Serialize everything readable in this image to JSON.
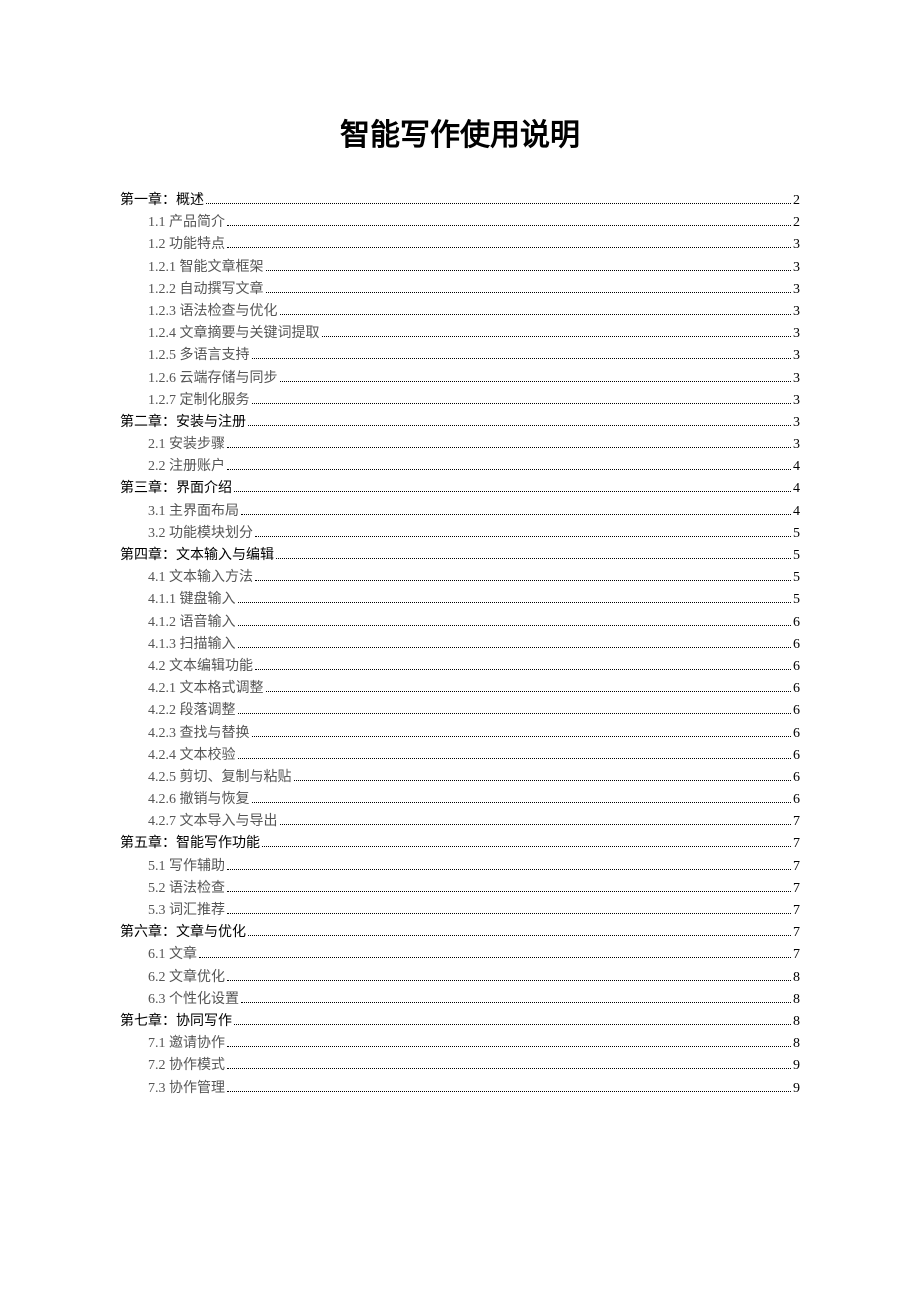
{
  "title": "智能写作使用说明",
  "toc": [
    {
      "label": "第一章：概述",
      "page": "2",
      "level": 0,
      "grey": false
    },
    {
      "label": "1.1 产品简介",
      "page": "2",
      "level": 1,
      "grey": true
    },
    {
      "label": "1.2 功能特点",
      "page": "3",
      "level": 1,
      "grey": true
    },
    {
      "label": "1.2.1 智能文章框架",
      "page": "3",
      "level": 1,
      "grey": true
    },
    {
      "label": "1.2.2 自动撰写文章",
      "page": "3",
      "level": 1,
      "grey": true
    },
    {
      "label": "1.2.3 语法检查与优化",
      "page": "3",
      "level": 1,
      "grey": true
    },
    {
      "label": "1.2.4 文章摘要与关键词提取",
      "page": "3",
      "level": 1,
      "grey": true
    },
    {
      "label": "1.2.5 多语言支持",
      "page": "3",
      "level": 1,
      "grey": true
    },
    {
      "label": "1.2.6 云端存储与同步",
      "page": "3",
      "level": 1,
      "grey": true
    },
    {
      "label": "1.2.7 定制化服务",
      "page": "3",
      "level": 1,
      "grey": true
    },
    {
      "label": "第二章：安装与注册",
      "page": "3",
      "level": 0,
      "grey": false
    },
    {
      "label": "2.1 安装步骤",
      "page": "3",
      "level": 1,
      "grey": true
    },
    {
      "label": "2.2 注册账户",
      "page": "4",
      "level": 1,
      "grey": true
    },
    {
      "label": "第三章：界面介绍",
      "page": "4",
      "level": 0,
      "grey": false
    },
    {
      "label": "3.1 主界面布局",
      "page": "4",
      "level": 1,
      "grey": true
    },
    {
      "label": "3.2 功能模块划分",
      "page": "5",
      "level": 1,
      "grey": true
    },
    {
      "label": "第四章：文本输入与编辑",
      "page": "5",
      "level": 0,
      "grey": false
    },
    {
      "label": "4.1 文本输入方法",
      "page": "5",
      "level": 1,
      "grey": true
    },
    {
      "label": "4.1.1 键盘输入",
      "page": "5",
      "level": 1,
      "grey": true
    },
    {
      "label": "4.1.2 语音输入",
      "page": "6",
      "level": 1,
      "grey": true
    },
    {
      "label": "4.1.3 扫描输入",
      "page": "6",
      "level": 1,
      "grey": true
    },
    {
      "label": "4.2 文本编辑功能",
      "page": "6",
      "level": 1,
      "grey": true
    },
    {
      "label": "4.2.1 文本格式调整",
      "page": "6",
      "level": 1,
      "grey": true
    },
    {
      "label": "4.2.2 段落调整",
      "page": "6",
      "level": 1,
      "grey": true
    },
    {
      "label": "4.2.3 查找与替换",
      "page": "6",
      "level": 1,
      "grey": true
    },
    {
      "label": "4.2.4 文本校验",
      "page": "6",
      "level": 1,
      "grey": true
    },
    {
      "label": "4.2.5 剪切、复制与粘贴",
      "page": "6",
      "level": 1,
      "grey": true
    },
    {
      "label": "4.2.6 撤销与恢复",
      "page": "6",
      "level": 1,
      "grey": true
    },
    {
      "label": "4.2.7 文本导入与导出",
      "page": "7",
      "level": 1,
      "grey": true
    },
    {
      "label": "第五章：智能写作功能",
      "page": "7",
      "level": 0,
      "grey": false
    },
    {
      "label": "5.1 写作辅助",
      "page": "7",
      "level": 1,
      "grey": true
    },
    {
      "label": "5.2 语法检查",
      "page": "7",
      "level": 1,
      "grey": true
    },
    {
      "label": "5.3 词汇推荐",
      "page": "7",
      "level": 1,
      "grey": true
    },
    {
      "label": "第六章：文章与优化",
      "page": "7",
      "level": 0,
      "grey": false
    },
    {
      "label": "6.1 文章",
      "page": "7",
      "level": 1,
      "grey": true
    },
    {
      "label": "6.2 文章优化",
      "page": "8",
      "level": 1,
      "grey": true
    },
    {
      "label": "6.3 个性化设置",
      "page": "8",
      "level": 1,
      "grey": true
    },
    {
      "label": "第七章：协同写作",
      "page": "8",
      "level": 0,
      "grey": false
    },
    {
      "label": "7.1 邀请协作",
      "page": "8",
      "level": 1,
      "grey": true
    },
    {
      "label": "7.2 协作模式",
      "page": "9",
      "level": 1,
      "grey": true
    },
    {
      "label": "7.3 协作管理",
      "page": "9",
      "level": 1,
      "grey": true
    }
  ]
}
